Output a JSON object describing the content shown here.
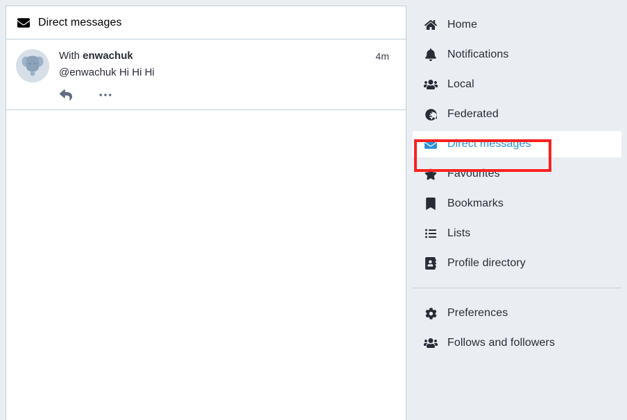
{
  "column": {
    "header": {
      "icon": "envelope-icon",
      "title": "Direct messages"
    },
    "conversations": [
      {
        "avatar_icon": "elephant-avatar-placeholder",
        "with_prefix": "With ",
        "with_account": "enwachuk",
        "message": "@enwachuk Hi Hi Hi",
        "time": "4m",
        "actions": [
          {
            "name": "reply-icon",
            "label": "Reply"
          },
          {
            "name": "ellipsis-icon",
            "label": "More"
          }
        ]
      }
    ]
  },
  "sidebar": {
    "items": [
      {
        "label": "Home",
        "icon": "home-icon",
        "active": false
      },
      {
        "label": "Notifications",
        "icon": "bell-icon",
        "active": false
      },
      {
        "label": "Local",
        "icon": "users-icon",
        "active": false
      },
      {
        "label": "Federated",
        "icon": "globe-icon",
        "active": false
      },
      {
        "label": "Direct messages",
        "icon": "envelope-icon",
        "active": true
      },
      {
        "label": "Favourites",
        "icon": "star-icon",
        "active": false
      },
      {
        "label": "Bookmarks",
        "icon": "bookmark-icon",
        "active": false
      },
      {
        "label": "Lists",
        "icon": "list-icon",
        "active": false
      },
      {
        "label": "Profile directory",
        "icon": "address-book-icon",
        "active": false
      }
    ],
    "items_secondary": [
      {
        "label": "Preferences",
        "icon": "gear-icon",
        "active": false
      },
      {
        "label": "Follows and followers",
        "icon": "users-icon",
        "active": false
      }
    ]
  },
  "colors": {
    "accent": "#2b90d9",
    "highlight": "#fa2020",
    "sidebar_bg": "#eaeef2",
    "panel_bg": "#ffffff",
    "border": "#c0cdd9",
    "text": "#282c37"
  }
}
